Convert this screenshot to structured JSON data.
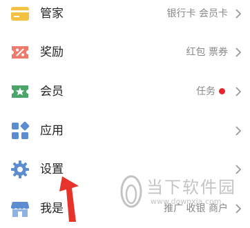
{
  "menu": {
    "items": [
      {
        "label": "管家",
        "detail": "银行卡 会员卡",
        "icon": "card-icon",
        "icon_color": "#F3C242"
      },
      {
        "label": "奖励",
        "detail": "红包 票券",
        "icon": "coupon-icon",
        "icon_color": "#EF7A6E"
      },
      {
        "label": "会员",
        "detail": "任务",
        "icon": "member-ticket-icon",
        "icon_color": "#4BA56A",
        "badge_color": "#E8222A"
      },
      {
        "label": "应用",
        "detail": "",
        "icon": "apps-grid-icon",
        "icon_color": "#5B8DD0"
      },
      {
        "label": "设置",
        "detail": "",
        "icon": "gear-icon",
        "icon_color": "#5B8DD0"
      },
      {
        "label": "我是",
        "detail": "推广 收银 商户",
        "icon": "storefront-icon",
        "icon_color": "#5B8DD0"
      }
    ]
  },
  "annotation": {
    "arrow_color": "#E8332A"
  },
  "watermark": {
    "title": "当下软件园",
    "url": "www.downxia.com"
  }
}
